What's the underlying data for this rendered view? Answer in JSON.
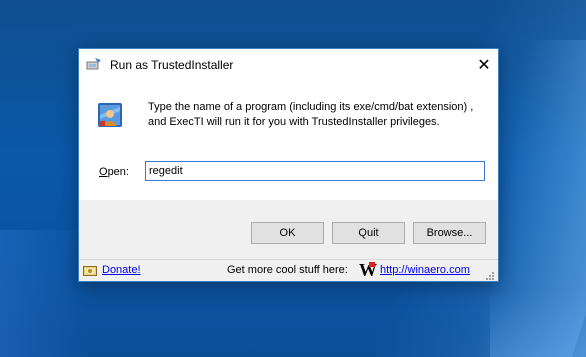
{
  "window": {
    "title": "Run as TrustedInstaller",
    "close_glyph": "✕"
  },
  "dialog": {
    "description": "Type the name of a program (including its exe/cmd/bat extension) , and ExecTI will run it for you with TrustedInstaller privileges.",
    "open_label": "Open:",
    "open_value": "regedit"
  },
  "buttons": {
    "ok": "OK",
    "quit": "Quit",
    "browse": "Browse..."
  },
  "statusbar": {
    "donate": "Donate!",
    "promo": "Get more cool stuff here:",
    "logo_letter": "W",
    "site": "http://winaero.com"
  },
  "icons": {
    "title": "run-icon",
    "app": "user-shield-icon",
    "donate": "donate-icon",
    "grip": "resize-grip-icon"
  },
  "colors": {
    "accent": "#3b7bd5",
    "link": "#0000ee",
    "desktop": "#0a58a8"
  }
}
